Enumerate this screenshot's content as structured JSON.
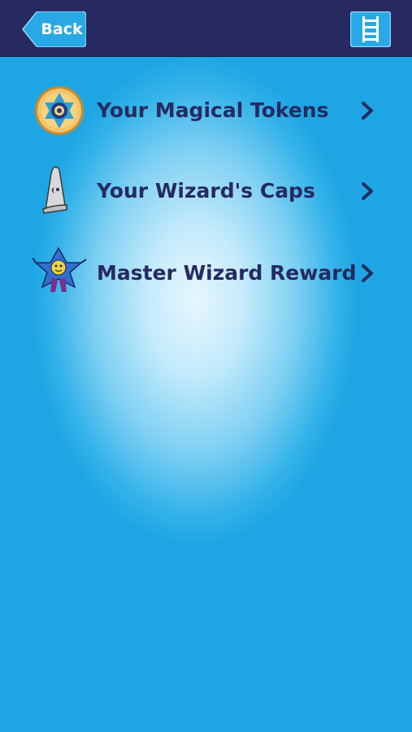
{
  "header": {
    "back_label": "Back",
    "menu_icon": "ladder-icon"
  },
  "menu": {
    "items": [
      {
        "label": "Your Magical Tokens",
        "icon": "token-icon"
      },
      {
        "label": "Your Wizard's Caps",
        "icon": "wizard-cap-icon"
      },
      {
        "label": "Master Wizard Reward",
        "icon": "wizard-star-icon"
      }
    ]
  },
  "colors": {
    "header_bg": "#262a61",
    "background": "#1ea6e4",
    "button_blue": "#29a8e6",
    "text": "#262a61"
  }
}
